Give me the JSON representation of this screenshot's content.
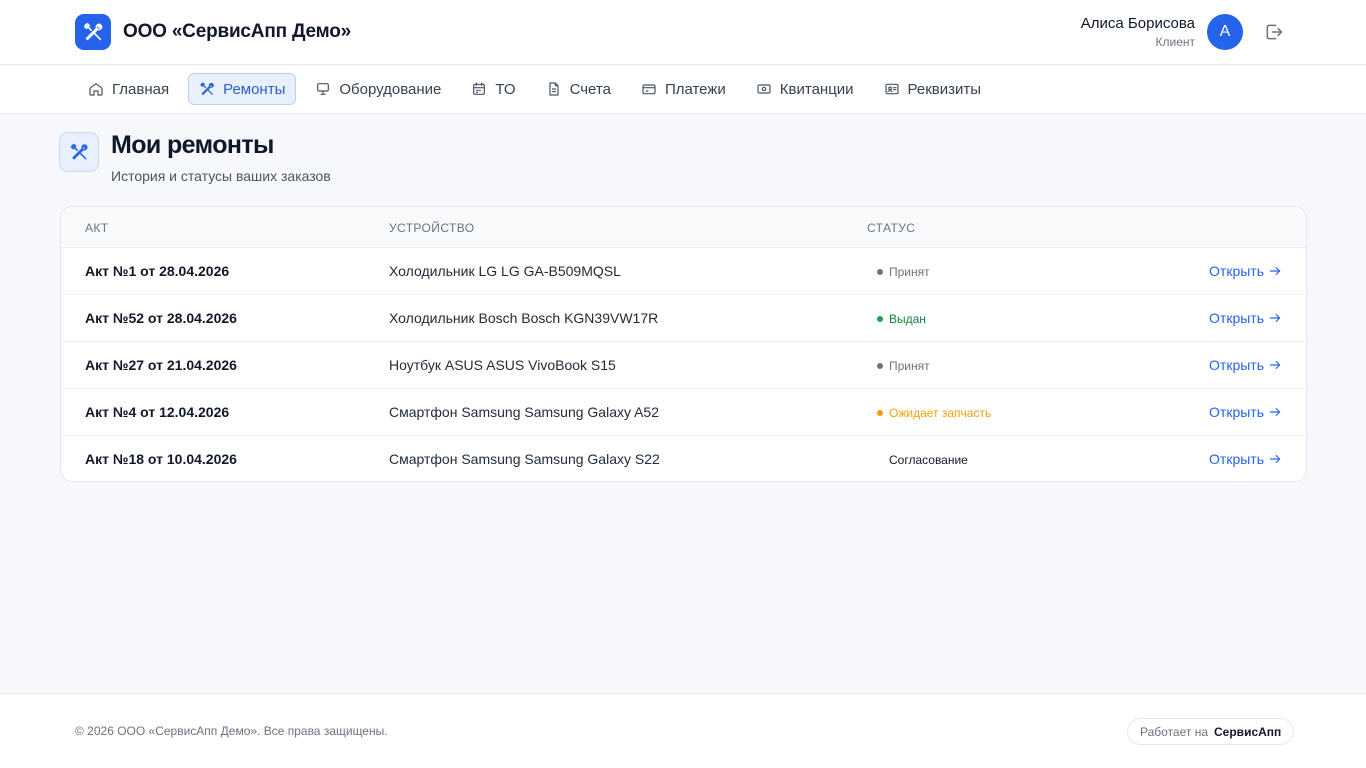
{
  "header": {
    "company": "ООО «СервисАпп Демо»",
    "user_name": "Алиса Борисова",
    "user_role": "Клиент",
    "avatar_letter": "А"
  },
  "nav": {
    "items": [
      {
        "label": "Главная",
        "icon": "home-icon"
      },
      {
        "label": "Ремонты",
        "icon": "wrench-icon",
        "active": true
      },
      {
        "label": "Оборудование",
        "icon": "monitor-icon"
      },
      {
        "label": "ТО",
        "icon": "calendar-icon"
      },
      {
        "label": "Счета",
        "icon": "document-icon"
      },
      {
        "label": "Платежи",
        "icon": "credit-card-icon"
      },
      {
        "label": "Квитанции",
        "icon": "receipt-icon"
      },
      {
        "label": "Реквизиты",
        "icon": "id-card-icon"
      }
    ]
  },
  "page": {
    "title": "Мои ремонты",
    "subtitle": "История и статусы ваших заказов"
  },
  "table": {
    "headers": {
      "act": "АКТ",
      "device": "УСТРОЙСТВО",
      "status": "СТАТУС"
    },
    "open_label": "Открыть",
    "rows": [
      {
        "act": "Акт №1 от 28.04.2026",
        "device": "Холодильник LG LG GA-B509MQSL",
        "status": "Принят",
        "status_color": "#6b7280",
        "dot_color": "#6b7280"
      },
      {
        "act": "Акт №52 от 28.04.2026",
        "device": "Холодильник Bosch Bosch KGN39VW17R",
        "status": "Выдан",
        "status_color": "#15803d",
        "dot_color": "#16a34a"
      },
      {
        "act": "Акт №27 от 21.04.2026",
        "device": "Ноутбук ASUS ASUS VivoBook S15",
        "status": "Принят",
        "status_color": "#6b7280",
        "dot_color": "#6b7280"
      },
      {
        "act": "Акт №4 от 12.04.2026",
        "device": "Смартфон Samsung Samsung Galaxy A52",
        "status": "Ожидает запчасть",
        "status_color": "#f59e0b",
        "dot_color": "#f59e0b"
      },
      {
        "act": "Акт №18 от 10.04.2026",
        "device": "Смартфон Samsung Samsung Galaxy S22",
        "status": "Согласование",
        "status_color": "#111827",
        "dot_color": ""
      }
    ]
  },
  "footer": {
    "copyright": "© 2026 ООО «СервисАпп Демо». Все права защищены.",
    "powered_label": "Работает на",
    "powered_brand": "СервисАпп"
  },
  "colors": {
    "accent": "#2563eb",
    "background": "#f7f8fb"
  }
}
